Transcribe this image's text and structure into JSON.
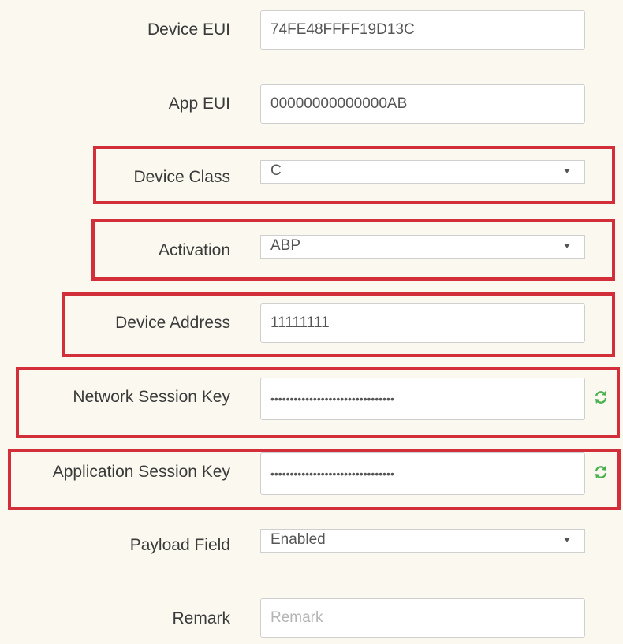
{
  "form": {
    "device_eui": {
      "label": "Device EUI",
      "value": "74FE48FFFF19D13C"
    },
    "app_eui": {
      "label": "App EUI",
      "value": "00000000000000AB"
    },
    "device_class": {
      "label": "Device Class",
      "value": "C"
    },
    "activation": {
      "label": "Activation",
      "value": "ABP"
    },
    "device_address": {
      "label": "Device Address",
      "value": "11111111"
    },
    "network_session_key": {
      "label": "Network Session Key",
      "value": "••••••••••••••••••••••••••••••••"
    },
    "application_session_key": {
      "label": "Application Session Key",
      "value": "••••••••••••••••••••••••••••••••"
    },
    "payload_field": {
      "label": "Payload Field",
      "value": "Enabled"
    },
    "remark": {
      "label": "Remark",
      "placeholder": "Remark"
    }
  },
  "icons": {
    "refresh": "refresh-icon",
    "caret": "chevron-down-icon"
  },
  "colors": {
    "highlight": "#d32f3a",
    "refresh_icon": "#4caf50",
    "background": "#fbf9ef"
  }
}
